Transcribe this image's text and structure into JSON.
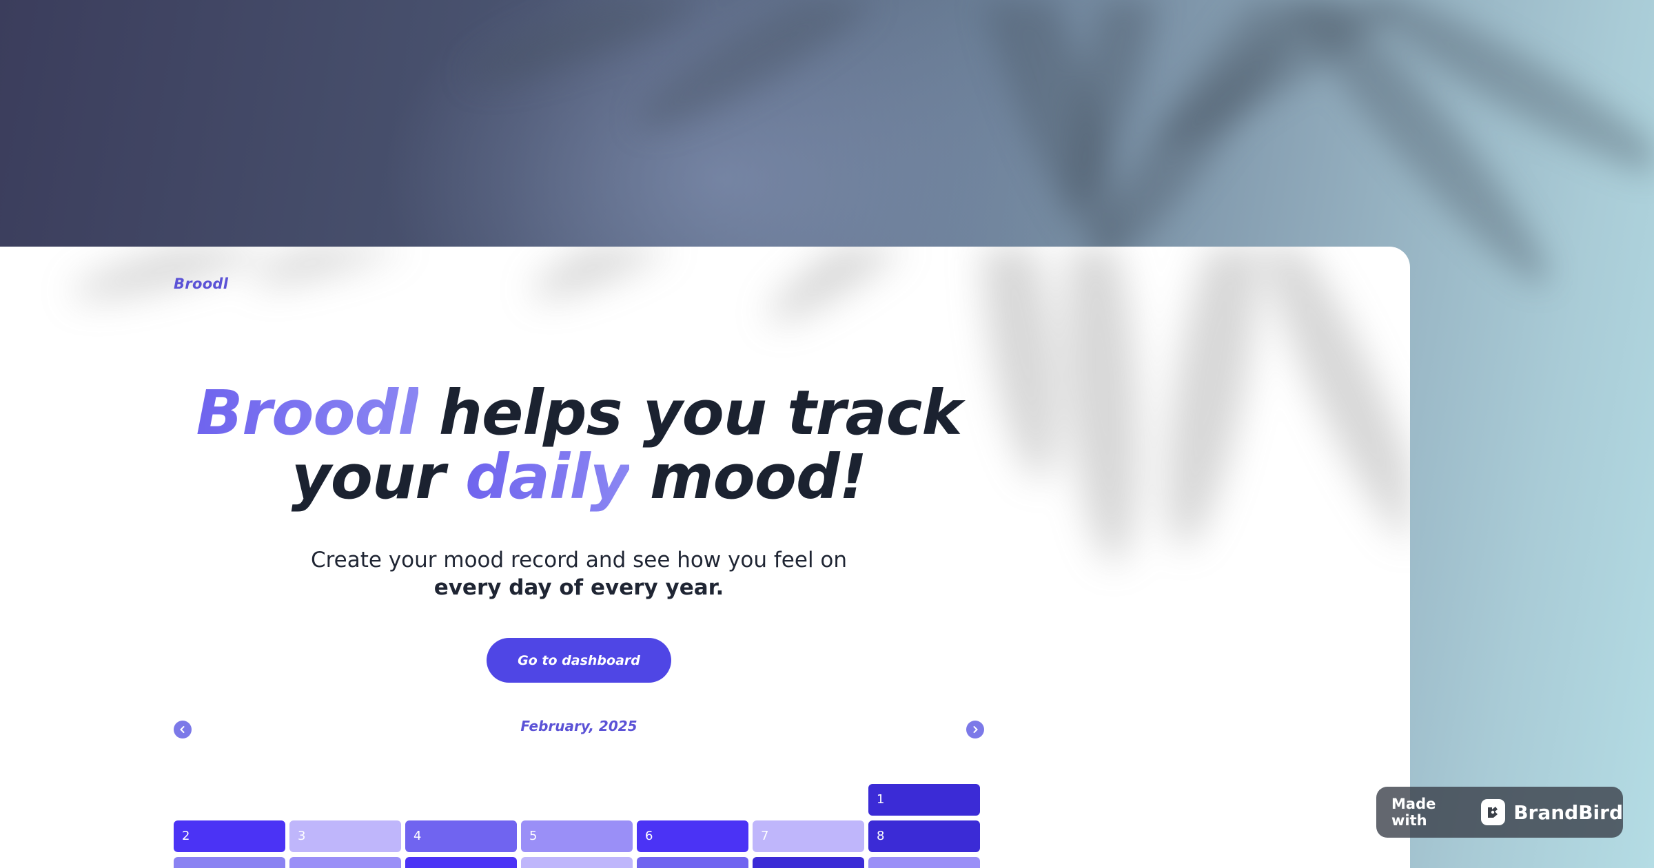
{
  "brand": {
    "logo_text": "Broodl",
    "accent_color": "#5b52d6",
    "button_color": "#4f46e5"
  },
  "hero": {
    "line1_accent": "Broodl",
    "line1_rest": " helps you track",
    "line2_start": "your ",
    "line2_accent": "daily",
    "line2_end": " mood!"
  },
  "subtitle": {
    "line1": "Create your mood record and see how you feel on",
    "line2": "every day of every year."
  },
  "cta": {
    "label": "Go to dashboard"
  },
  "calendar": {
    "month_label": "February, 2025",
    "prev_icon": "chevron-left-icon",
    "next_icon": "chevron-right-icon",
    "days": [
      {
        "label": "",
        "color": ""
      },
      {
        "label": "",
        "color": ""
      },
      {
        "label": "",
        "color": ""
      },
      {
        "label": "",
        "color": ""
      },
      {
        "label": "",
        "color": ""
      },
      {
        "label": "",
        "color": ""
      },
      {
        "label": "1",
        "color": "#3b2bd6"
      },
      {
        "label": "2",
        "color": "#4b33f5"
      },
      {
        "label": "3",
        "color": "#bfb6fb"
      },
      {
        "label": "4",
        "color": "#7064f0"
      },
      {
        "label": "5",
        "color": "#9a8ff7"
      },
      {
        "label": "6",
        "color": "#4b33f5"
      },
      {
        "label": "7",
        "color": "#bfb6fb"
      },
      {
        "label": "8",
        "color": "#3b2bd6"
      },
      {
        "label": "",
        "color": "#8a82f2"
      },
      {
        "label": "",
        "color": "#9a8ff7"
      },
      {
        "label": "",
        "color": "#4b33f5"
      },
      {
        "label": "",
        "color": "#bfb6fb"
      },
      {
        "label": "",
        "color": "#7064f0"
      },
      {
        "label": "",
        "color": "#3b2bd6"
      },
      {
        "label": "",
        "color": "#9a8ff7"
      }
    ]
  },
  "badge": {
    "made_with": "Made with",
    "brand_name": "BrandBird",
    "icon": "brandbird-logo-icon"
  }
}
